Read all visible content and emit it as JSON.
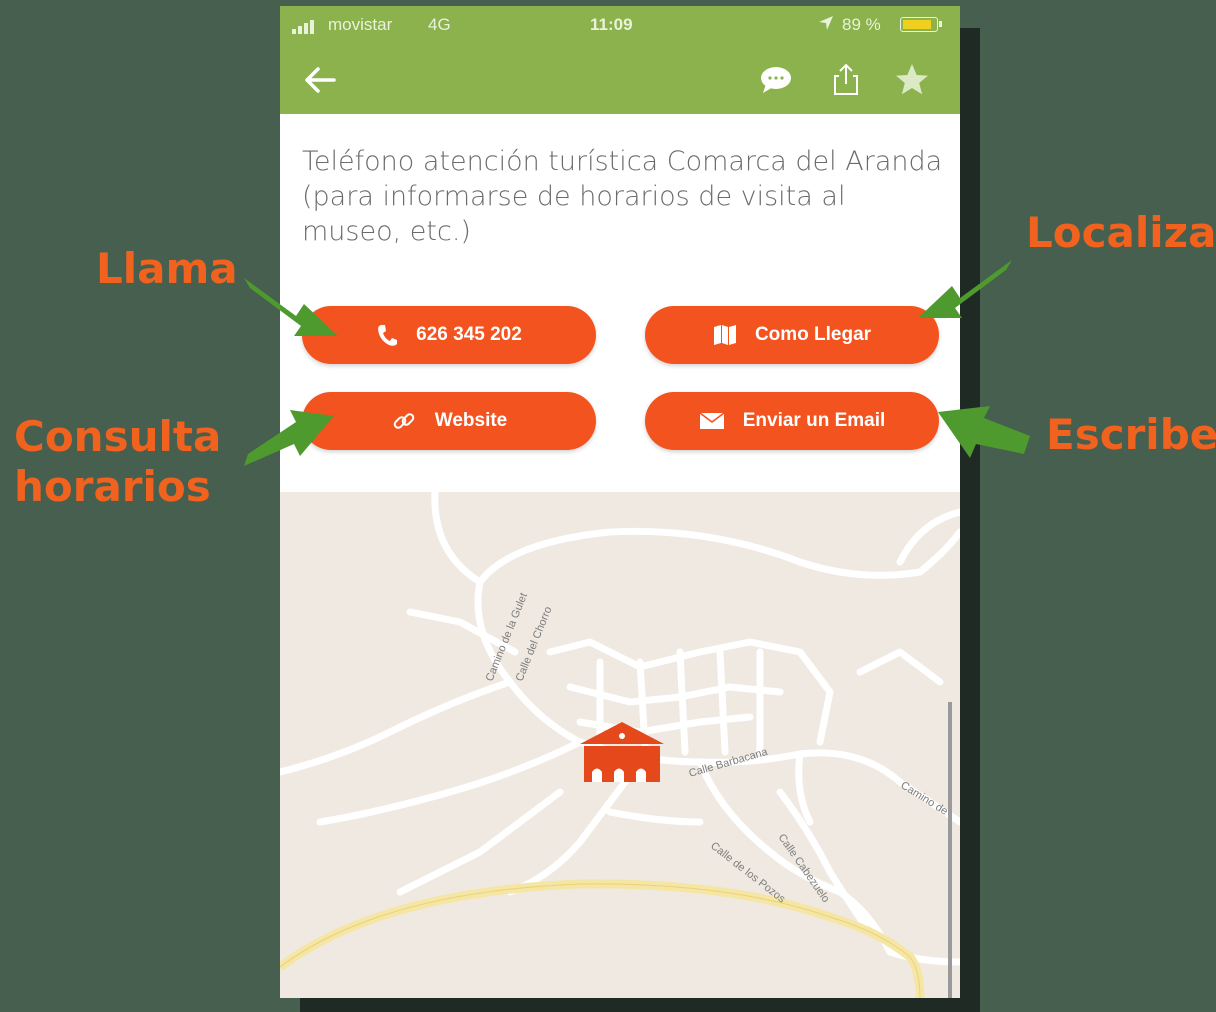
{
  "status_bar": {
    "carrier": "movistar",
    "network": "4G",
    "time": "11:09",
    "battery": "89 %",
    "battery_level": 0.89
  },
  "nav": {
    "icons": [
      "back-arrow-icon",
      "chat-icon",
      "share-icon",
      "star-icon"
    ]
  },
  "description": "Teléfono atención turística Comarca del Aranda (para informarse de horarios de visita al museo, etc.)",
  "actions": {
    "phone_label": "626 345 202",
    "directions_label": "Como Llegar",
    "website_label": "Website",
    "email_label": "Enviar un Email"
  },
  "map": {
    "streets": [
      "Camino de la Gulet",
      "Calle del Chorro",
      "Calle Barbacana",
      "Camino de",
      "Calle de los Pozos",
      "Calle Cabezuelo"
    ],
    "marker": "museum-marker-icon"
  },
  "annotations": {
    "llama": "Llama",
    "localiza": "Localiza",
    "consulta": "Consulta horarios",
    "escribe": "Escribe"
  },
  "colors": {
    "header": "#8bb24c",
    "button": "#f2531f",
    "annotation": "#f2621f",
    "arrow": "#4e9a2f",
    "background": "#465f4e"
  }
}
